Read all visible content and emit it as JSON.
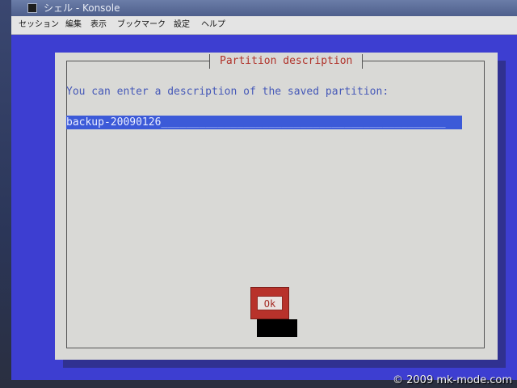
{
  "window": {
    "title": "シェル - Konsole"
  },
  "menubar": {
    "items": [
      {
        "label": "セッション"
      },
      {
        "label": "編集"
      },
      {
        "label": "表示"
      },
      {
        "label": "ブックマーク"
      },
      {
        "label": "設定"
      },
      {
        "label": "ヘルプ"
      }
    ]
  },
  "dialog": {
    "title": "Partition description",
    "prompt": "You can enter a description of the saved partition:",
    "input_value": "backup-20090126",
    "ok_label": "Ok"
  },
  "watermark": {
    "text": "© 2009 mk-mode.com"
  },
  "colors": {
    "terminal_background": "#3d3ed1",
    "dialog_background": "#d9d9d6",
    "dialog_title": "#b0332b",
    "prompt_text": "#4659b8",
    "input_background": "#3c5ad8",
    "ok_button": "#b8322b"
  },
  "icons": {
    "window_icon": "terminal-icon"
  }
}
